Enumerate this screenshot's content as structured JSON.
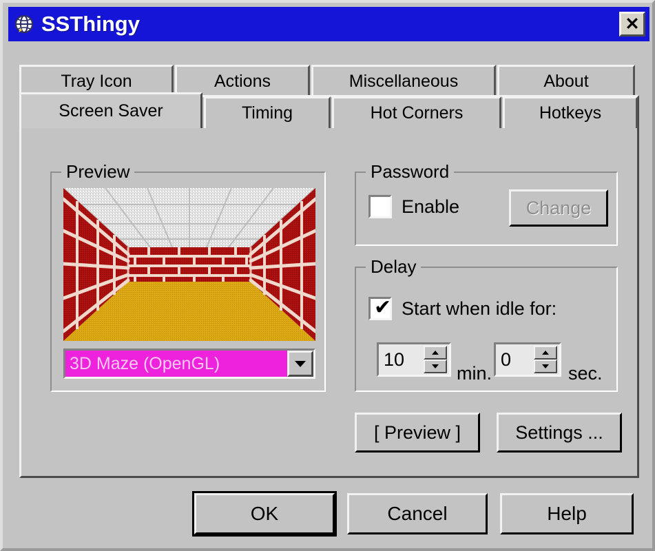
{
  "window": {
    "title": "SSThingy",
    "icon": "globe-icon",
    "close_label": "✕",
    "titlebar_color": "#1515d8",
    "face_color": "#c3c3c3"
  },
  "tabs": {
    "top_row": [
      {
        "label": "Tray Icon",
        "active": false
      },
      {
        "label": "Actions",
        "active": false
      },
      {
        "label": "Miscellaneous",
        "active": false
      },
      {
        "label": "About",
        "active": false
      }
    ],
    "bottom_row": [
      {
        "label": "Screen Saver",
        "active": true
      },
      {
        "label": "Timing",
        "active": false
      },
      {
        "label": "Hot Corners",
        "active": false
      },
      {
        "label": "Hotkeys",
        "active": false
      }
    ]
  },
  "preview_group": {
    "label": "Preview",
    "screensaver_selected": "3D Maze (OpenGL)",
    "combo_highlight_color": "#ee22dd",
    "combo_text_color": "#f6c8f0",
    "dropdown_icon": "chevron-down-icon"
  },
  "password_group": {
    "label": "Password",
    "enable_label": "Enable",
    "enable_checked": false,
    "change_label": "Change",
    "change_enabled": false
  },
  "delay_group": {
    "label": "Delay",
    "idle_label": "Start when idle for:",
    "idle_checked": true,
    "checked_glyph": "✔",
    "minutes_value": "10",
    "minutes_unit": "min.",
    "seconds_value": "0",
    "seconds_unit": "sec.",
    "spin_up_icon": "caret-up-icon",
    "spin_down_icon": "caret-down-icon"
  },
  "actions": {
    "preview_label": "[ Preview ]",
    "settings_label": "Settings ..."
  },
  "bottom_buttons": {
    "ok_label": "OK",
    "cancel_label": "Cancel",
    "help_label": "Help"
  },
  "maze_art": {
    "description": "3D Maze screensaver corridor preview",
    "brick_color": "#a81010",
    "brick_dark_color": "#8a0808",
    "mortar_color": "#f0d8cc",
    "ceiling_color": "#dcdcdc",
    "ceiling_speckle_color": "#ffffff",
    "floor_color": "#d9a510",
    "floor_dark_color": "#c08f0c",
    "background_color": "#b8b8b8"
  }
}
